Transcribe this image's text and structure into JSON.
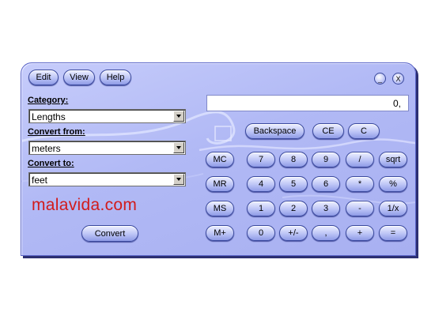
{
  "menu": {
    "edit": "Edit",
    "view": "View",
    "help": "Help"
  },
  "window_controls": {
    "minimize": "_",
    "close": "X"
  },
  "converter": {
    "category_label": "Category:",
    "category_value": "Lengths",
    "from_label": "Convert from:",
    "from_value": "meters",
    "to_label": "Convert to:",
    "to_value": "feet",
    "convert_button": "Convert"
  },
  "watermark": "malavida.com",
  "display": {
    "value": "0,"
  },
  "keys": {
    "backspace": "Backspace",
    "ce": "CE",
    "c": "C",
    "mc": "MC",
    "mr": "MR",
    "ms": "MS",
    "mplus": "M+",
    "seven": "7",
    "eight": "8",
    "nine": "9",
    "divide": "/",
    "sqrt": "sqrt",
    "four": "4",
    "five": "5",
    "six": "6",
    "multiply": "*",
    "percent": "%",
    "one": "1",
    "two": "2",
    "three": "3",
    "minus": "-",
    "reciprocal": "1/x",
    "zero": "0",
    "plusminus": "+/-",
    "decimal": ",",
    "plus": "+",
    "equals": "="
  },
  "colors": {
    "window_bg": "#b1b9f5",
    "border": "#5a64c8",
    "watermark": "#d21b1b",
    "shadow": "#2c2f72"
  }
}
